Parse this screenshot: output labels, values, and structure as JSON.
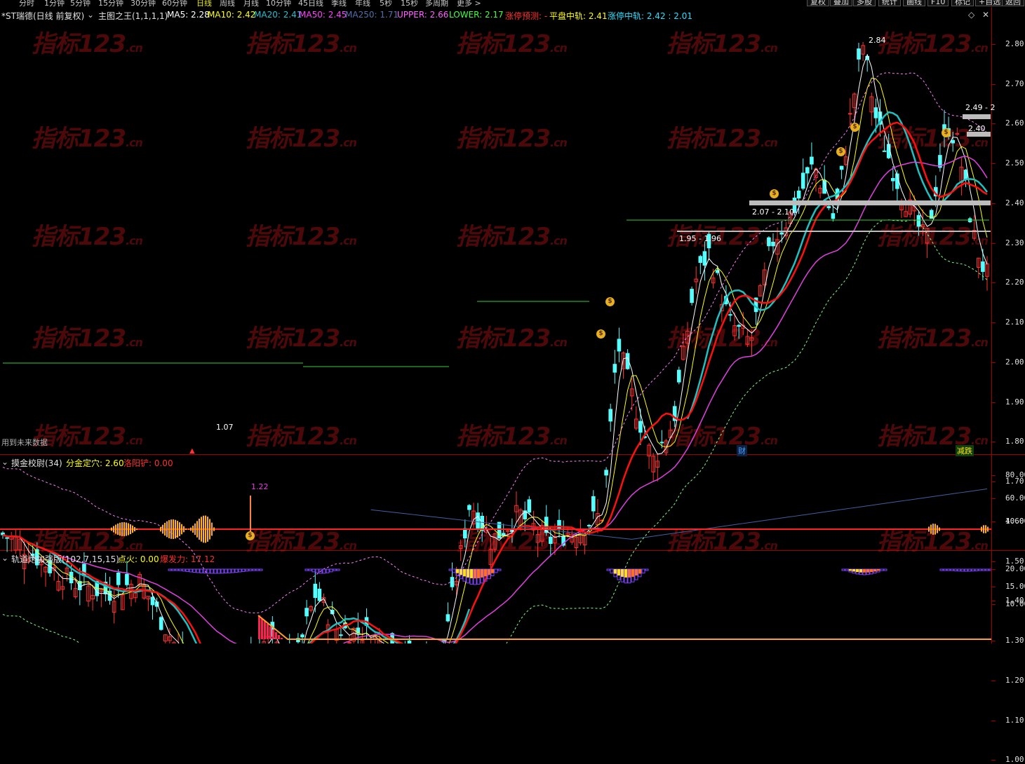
{
  "topbar": {
    "periods": [
      "分时",
      "1分钟",
      "5分钟",
      "15分钟",
      "30分钟",
      "60分钟",
      "日线",
      "周线",
      "月线",
      "10分钟",
      "45日线",
      "季线",
      "年线",
      "5秒",
      "15秒",
      "多周期",
      "更多 >"
    ],
    "active": "日线",
    "right_buttons": [
      "复权",
      "叠加",
      "多股",
      "统计",
      "画线",
      "F10",
      "标记",
      "+自选",
      "返回"
    ]
  },
  "main": {
    "stock_title": "*ST瑞德(日线 前复权)",
    "indicator_name": "主图之王(1,1,1,1)",
    "ma5": "MA5: 2.28",
    "ma10": "MA10: 2.42",
    "ma20": "MA20: 2.41",
    "ma50": "MA50: 2.45",
    "ma250": "MA250: 1.71",
    "upper": "UPPER: 2.66",
    "lower": "LOWER: 2.17",
    "zt_pred": "涨停预测: -",
    "pingpan": "平盘中轨: 2.41",
    "zt_mid": "涨停中轨: 2.42 : 2.01",
    "y_labels": [
      "2.80",
      "2.70",
      "2.60",
      "2.50",
      "2.40",
      "2.30",
      "2.20",
      "2.10",
      "2.00",
      "1.90",
      "1.80",
      "1.70",
      "1.60",
      "1.50",
      "1.40",
      "1.30",
      "1.20",
      "1.10",
      "1.00"
    ],
    "annot_high": "2.84",
    "annot_low": "1.07",
    "band1": "2.49 - 2",
    "band2": "2.40",
    "band3": "2.07 - 2.10",
    "band4": "1.95 - 1.96",
    "future_note": "用到未来数据",
    "badge_cai": "财",
    "badge_jian": "减跌"
  },
  "panel2": {
    "name": "摸金校尉(34)",
    "f1": "分金定穴: 2.60",
    "f2": "洛阳铲: 0.00",
    "y_labels": [
      "80.00",
      "60.00",
      "40.00"
    ],
    "spike_label": "1.22"
  },
  "panel3": {
    "name": "轨道炮加强版(102,7,15,15)",
    "f1": "点火: 0.00",
    "f2": "爆发力: 17.12",
    "y_labels": [
      "20.00",
      "15.00",
      "10.00"
    ]
  },
  "watermark": "指标123",
  "watermark_sub": ".cn",
  "colors": {
    "up": "#ff3030",
    "down": "#54ffff",
    "ma5": "#ffffff",
    "ma10": "#ffff00",
    "ma20": "#20c0c0",
    "ma50": "#e040e0",
    "ma250": "#4060a0",
    "thick": "#ff1010",
    "grid": "#a00000"
  }
}
